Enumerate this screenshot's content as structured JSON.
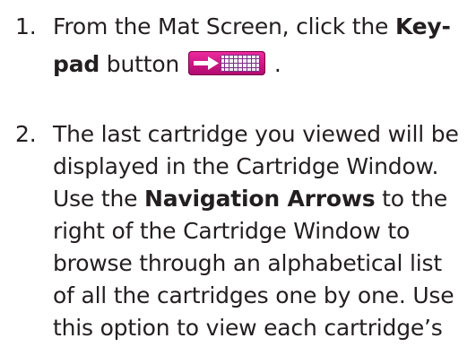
{
  "step1": {
    "number": "1.",
    "line1_text": "From the Mat Screen, click the ",
    "line1_bold": "Key-",
    "line2_bold": "pad",
    "line2_text": " button",
    "line2_end": "."
  },
  "step2": {
    "number": "2.",
    "line1": "The last cartridge you viewed will be",
    "line2": "displayed in the Cartridge Window.",
    "line3_text": "Use the ",
    "line3_bold": "Navigation Arrows",
    "line3_end": " to the",
    "line4": "right of the Cartridge Window to",
    "line5": "browse through an alphabetical list",
    "line6": "of all the cartridges one by one. Use",
    "line7": "this option to view each cartridge’s"
  },
  "icons": {
    "keypad_button": "keypad-arrow-grid-icon"
  },
  "colors": {
    "text": "#231f20",
    "keypad_button": "#d4178a"
  }
}
